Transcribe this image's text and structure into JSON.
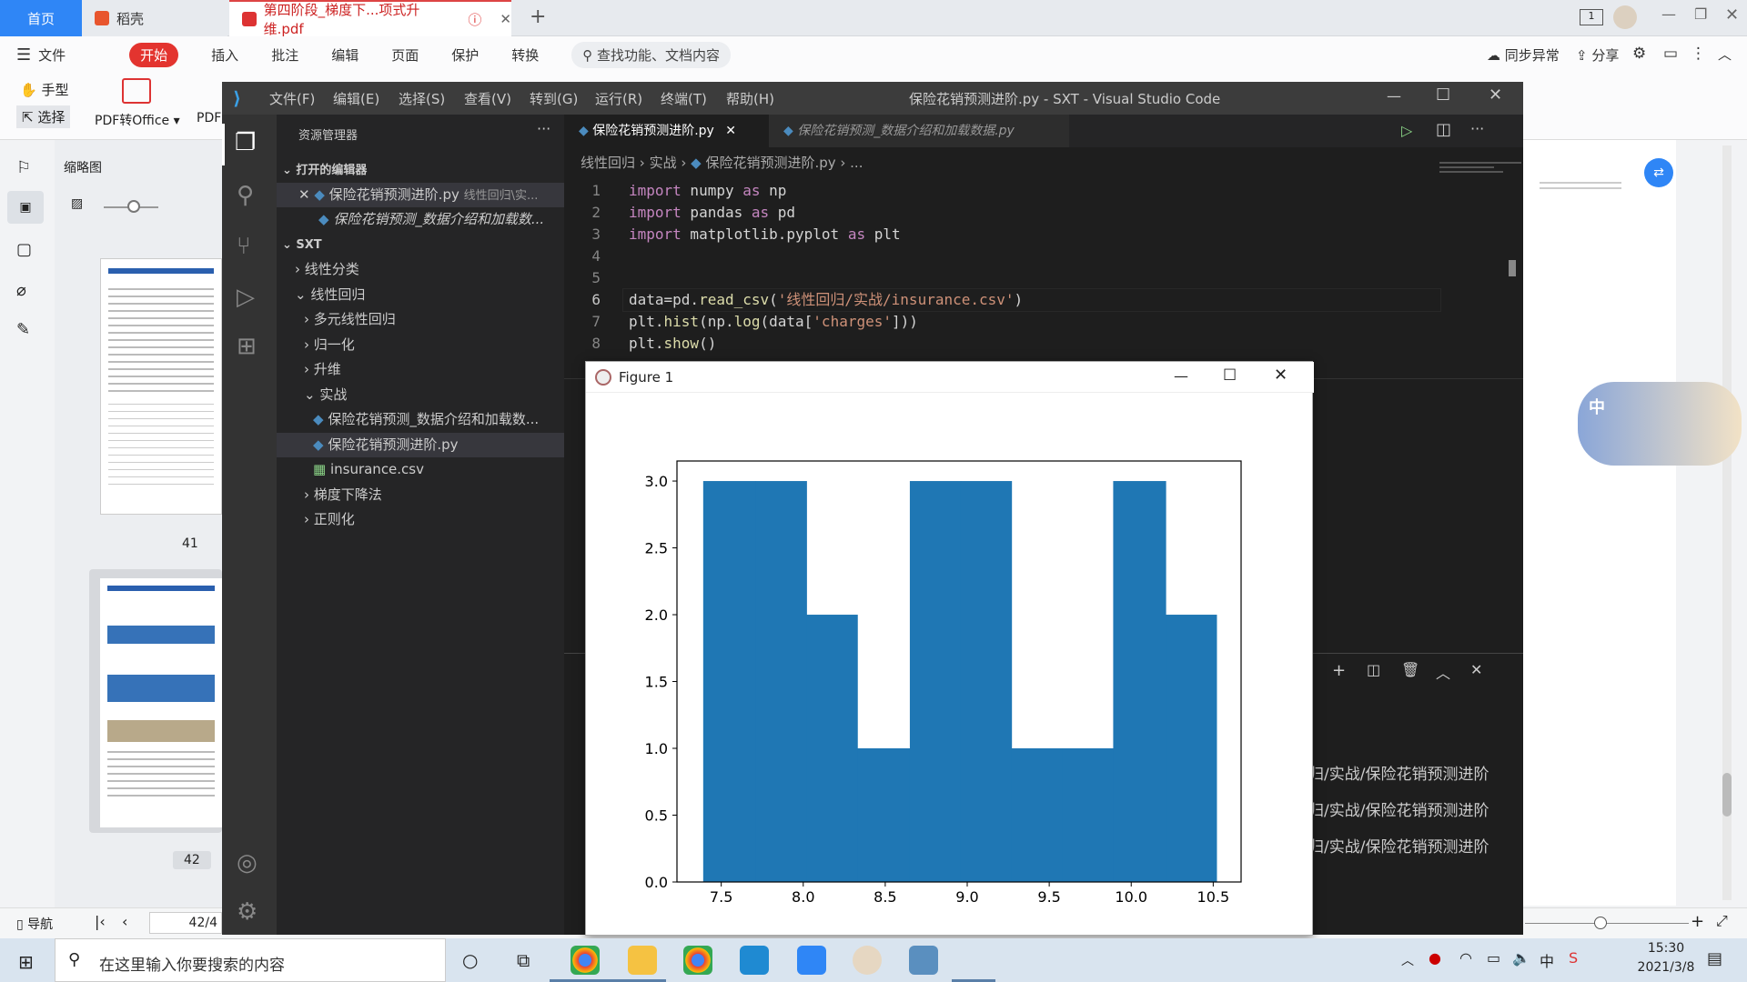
{
  "wps": {
    "tabs": [
      {
        "label": "首页"
      },
      {
        "label": "稻壳"
      },
      {
        "label": "第四阶段_梯度下...项式升维.pdf"
      }
    ],
    "menu": [
      "文件",
      "开始",
      "插入",
      "批注",
      "编辑",
      "页面",
      "保护",
      "转换"
    ],
    "search_placeholder": "查找功能、文档内容",
    "sync_label": "同步异常",
    "share_label": "分享",
    "tools": {
      "hand": "手型",
      "select": "选择",
      "pdf_to_office": "PDF转Office",
      "pdf_short": "PDF"
    },
    "thumb_title": "缩略图",
    "thumb_pages": [
      "41",
      "42"
    ],
    "nav_label": "导航",
    "page_indicator": "42/4"
  },
  "vscode": {
    "menu": [
      "文件(F)",
      "编辑(E)",
      "选择(S)",
      "查看(V)",
      "转到(G)",
      "运行(R)",
      "终端(T)",
      "帮助(H)"
    ],
    "title": "保险花销预测进阶.py - SXT - Visual Studio Code",
    "explorer_title": "资源管理器",
    "open_editors_label": "打开的编辑器",
    "open_editors": [
      {
        "name": "保险花销预测进阶.py",
        "path": "线性回归\\实..."
      },
      {
        "name": "保险花销预测_数据介绍和加载数..."
      }
    ],
    "workspace": "SXT",
    "tree": [
      {
        "label": "线性分类",
        "indent": 1,
        "kind": "folder-closed"
      },
      {
        "label": "线性回归",
        "indent": 1,
        "kind": "folder-open"
      },
      {
        "label": "多元线性回归",
        "indent": 2,
        "kind": "folder-closed"
      },
      {
        "label": "归一化",
        "indent": 2,
        "kind": "folder-closed"
      },
      {
        "label": "升维",
        "indent": 2,
        "kind": "folder-closed"
      },
      {
        "label": "实战",
        "indent": 2,
        "kind": "folder-open"
      },
      {
        "label": "保险花销预测_数据介绍和加载数...",
        "indent": 3,
        "kind": "py"
      },
      {
        "label": "保险花销预测进阶.py",
        "indent": 3,
        "kind": "py",
        "selected": true
      },
      {
        "label": "insurance.csv",
        "indent": 3,
        "kind": "csv"
      },
      {
        "label": "梯度下降法",
        "indent": 2,
        "kind": "folder-closed"
      },
      {
        "label": "正则化",
        "indent": 2,
        "kind": "folder-closed"
      }
    ],
    "tabs": [
      {
        "label": "保险花销预测进阶.py",
        "active": true
      },
      {
        "label": "保险花销预测_数据介绍和加载数据.py",
        "active": false
      }
    ],
    "breadcrumb": [
      "线性回归",
      "实战",
      "保险花销预测进阶.py",
      "..."
    ],
    "code": [
      {
        "n": "1",
        "tokens": [
          [
            "kw",
            "import"
          ],
          [
            "id",
            " numpy "
          ],
          [
            "kw",
            "as"
          ],
          [
            "id",
            " np"
          ]
        ]
      },
      {
        "n": "2",
        "tokens": [
          [
            "kw",
            "import"
          ],
          [
            "id",
            " pandas "
          ],
          [
            "kw",
            "as"
          ],
          [
            "id",
            " pd"
          ]
        ]
      },
      {
        "n": "3",
        "tokens": [
          [
            "kw",
            "import"
          ],
          [
            "id",
            " matplotlib.pyplot "
          ],
          [
            "kw",
            "as"
          ],
          [
            "id",
            " plt"
          ]
        ]
      },
      {
        "n": "4",
        "tokens": []
      },
      {
        "n": "5",
        "tokens": []
      },
      {
        "n": "6",
        "tokens": [
          [
            "id",
            "data=pd."
          ],
          [
            "fn",
            "read_csv"
          ],
          [
            "id",
            "("
          ],
          [
            "str",
            "'线性回归/实战/insurance.csv'"
          ],
          [
            "id",
            ")"
          ]
        ]
      },
      {
        "n": "7",
        "tokens": [
          [
            "id",
            "plt."
          ],
          [
            "fn",
            "hist"
          ],
          [
            "id",
            "(np."
          ],
          [
            "fn",
            "log"
          ],
          [
            "id",
            "(data["
          ],
          [
            "str",
            "'charges'"
          ],
          [
            "id",
            "]))"
          ]
        ]
      },
      {
        "n": "8",
        "tokens": [
          [
            "id",
            "plt."
          ],
          [
            "fn",
            "show"
          ],
          [
            "id",
            "()"
          ]
        ]
      }
    ],
    "terminal_lines": [
      "归/实战/保险花销预测进阶",
      "归/实战/保险花销预测进阶",
      "归/实战/保险花销预测进阶"
    ]
  },
  "figure": {
    "title": "Figure 1"
  },
  "chart_data": {
    "type": "bar",
    "bin_edges": [
      7.39,
      7.71,
      8.02,
      8.33,
      8.65,
      8.96,
      9.27,
      9.58,
      9.89,
      10.21,
      10.52
    ],
    "values": [
      3,
      3,
      2,
      1,
      3,
      3,
      1,
      1,
      3,
      2
    ],
    "xticks": [
      "7.5",
      "8.0",
      "8.5",
      "9.0",
      "9.5",
      "10.0",
      "10.5"
    ],
    "yticks": [
      "0.0",
      "0.5",
      "1.0",
      "1.5",
      "2.0",
      "2.5",
      "3.0"
    ],
    "xlim": [
      7.23,
      10.67
    ],
    "ylim": [
      0,
      3.15
    ],
    "bar_color": "#1f77b4"
  },
  "taskbar": {
    "search_placeholder": "在这里输入你要搜索的内容",
    "time": "15:30",
    "date": "2021/3/8",
    "ime": "中"
  }
}
